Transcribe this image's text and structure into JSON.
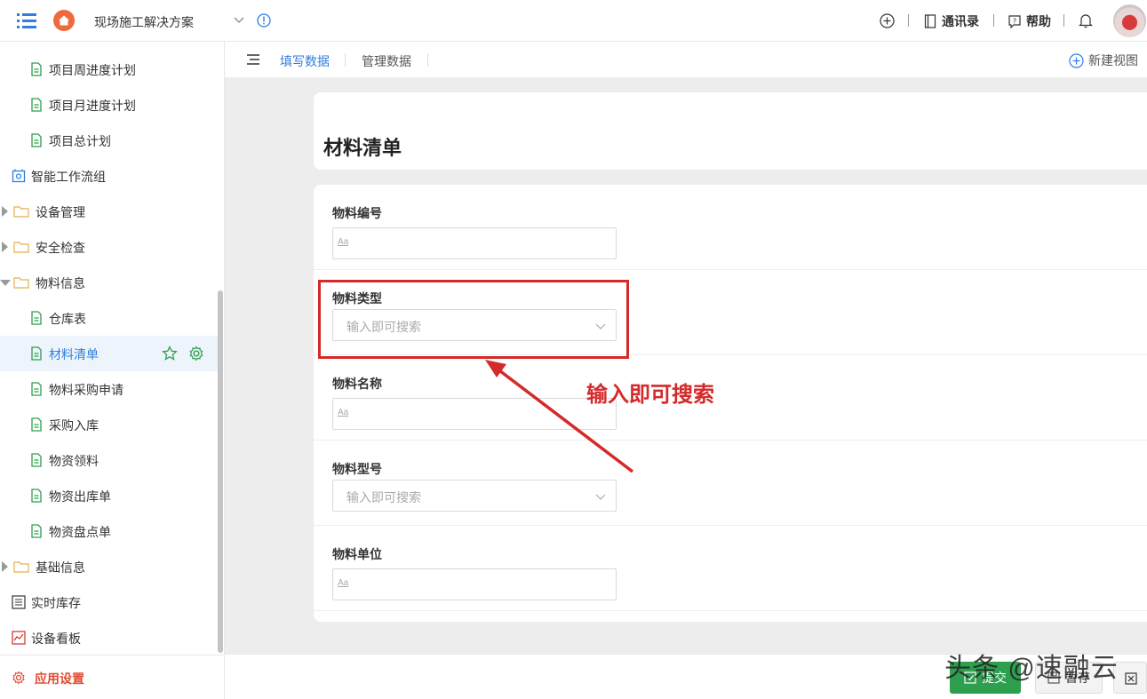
{
  "header": {
    "app_title": "现场施工解决方案",
    "contacts_label": "通讯录",
    "help_label": "帮助"
  },
  "sidebar": {
    "items": [
      {
        "label": "项目周进度计划"
      },
      {
        "label": "项目月进度计划"
      },
      {
        "label": "项目总计划"
      },
      {
        "label": "智能工作流组"
      },
      {
        "label": "设备管理"
      },
      {
        "label": "安全检查"
      },
      {
        "label": "物料信息"
      },
      {
        "label": "仓库表"
      },
      {
        "label": "材料清单"
      },
      {
        "label": "物料采购申请"
      },
      {
        "label": "采购入库"
      },
      {
        "label": "物资领料"
      },
      {
        "label": "物资出库单"
      },
      {
        "label": "物资盘点单"
      },
      {
        "label": "基础信息"
      },
      {
        "label": "实时库存"
      },
      {
        "label": "设备看板"
      }
    ],
    "settings_label": "应用设置"
  },
  "tabs": {
    "fill": "填写数据",
    "manage": "管理数据",
    "new_view": "新建视图"
  },
  "form": {
    "title": "材料清单",
    "fields": [
      {
        "label": "物料编号",
        "type": "text",
        "placeholder_icon": "Aa"
      },
      {
        "label": "物料类型",
        "type": "select",
        "placeholder": "输入即可搜索"
      },
      {
        "label": "物料名称",
        "type": "text",
        "placeholder_icon": "Aa"
      },
      {
        "label": "物料型号",
        "type": "select",
        "placeholder": "输入即可搜索"
      },
      {
        "label": "物料单位",
        "type": "text",
        "placeholder_icon": "Aa"
      }
    ]
  },
  "annotation": {
    "text": "输入即可搜索",
    "color": "#d42a2a"
  },
  "footer": {
    "submit_label": "提交",
    "draft_label": "暂存"
  },
  "watermark": "头条 @速融云",
  "colors": {
    "accent": "#2f7ee0",
    "danger": "#e24b32",
    "submit": "#2e9e4f",
    "doc_icon": "#2e9e4f"
  }
}
